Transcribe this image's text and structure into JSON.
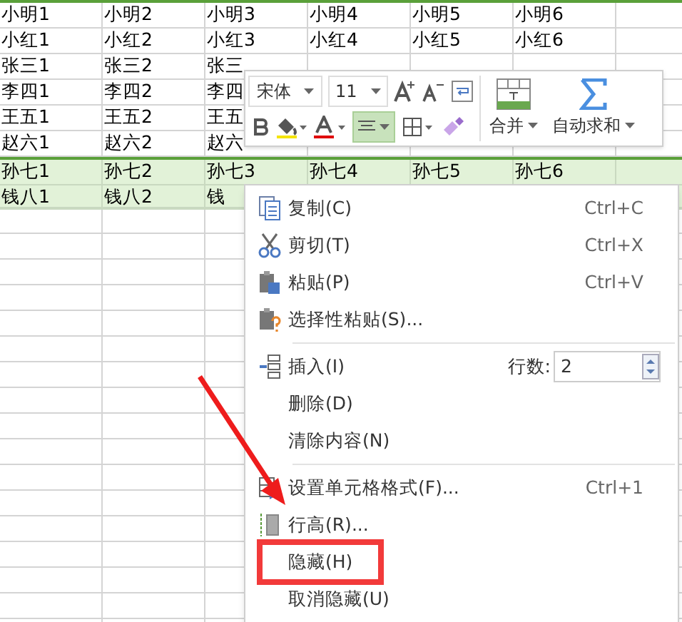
{
  "sheet": {
    "rows": [
      {
        "selected": false,
        "cells": [
          "小明1",
          "小明2",
          "小明3",
          "小明4",
          "小明5",
          "小明6"
        ]
      },
      {
        "selected": false,
        "cells": [
          "小红1",
          "小红2",
          "小红3",
          "小红4",
          "小红5",
          "小红6"
        ]
      },
      {
        "selected": false,
        "cells": [
          "张三1",
          "张三2",
          "张三"
        ]
      },
      {
        "selected": false,
        "cells": [
          "李四1",
          "李四2",
          "李四"
        ]
      },
      {
        "selected": false,
        "cells": [
          "王五1",
          "王五2",
          "王五"
        ]
      },
      {
        "selected": false,
        "cells": [
          "赵六1",
          "赵六2",
          "赵六"
        ]
      },
      {
        "selected": true,
        "cells": [
          "孙七1",
          "孙七2",
          "孙七3",
          "孙七4",
          "孙七5",
          "孙七6"
        ]
      },
      {
        "selected": true,
        "cells": [
          "钱八1",
          "钱八2",
          "钱"
        ]
      }
    ]
  },
  "toolbar": {
    "font": "宋体",
    "size": "11",
    "merge": "合并",
    "autosum": "自动求和",
    "align_selected": true
  },
  "context_menu": {
    "items": [
      {
        "kind": "command",
        "label": "复制(C)",
        "shortcut": "Ctrl+C",
        "highlighted": false
      },
      {
        "kind": "command",
        "label": "剪切(T)",
        "shortcut": "Ctrl+X",
        "highlighted": false
      },
      {
        "kind": "command",
        "label": "粘贴(P)",
        "shortcut": "Ctrl+V",
        "highlighted": false
      },
      {
        "kind": "command",
        "label": "选择性粘贴(S)...",
        "highlighted": false
      },
      {
        "kind": "separator"
      },
      {
        "kind": "insert",
        "label": "插入(I)",
        "count_label": "行数:",
        "count": "2",
        "highlighted": false
      },
      {
        "kind": "command",
        "label": "删除(D)",
        "highlighted": false
      },
      {
        "kind": "command",
        "label": "清除内容(N)",
        "highlighted": false
      },
      {
        "kind": "separator"
      },
      {
        "kind": "command",
        "label": "设置单元格格式(F)...",
        "shortcut": "Ctrl+1",
        "highlighted": false
      },
      {
        "kind": "command",
        "label": "行高(R)...",
        "highlighted": false
      },
      {
        "kind": "command",
        "label": "隐藏(H)",
        "highlighted": true
      },
      {
        "kind": "command",
        "label": "取消隐藏(U)",
        "highlighted": false
      }
    ]
  }
}
